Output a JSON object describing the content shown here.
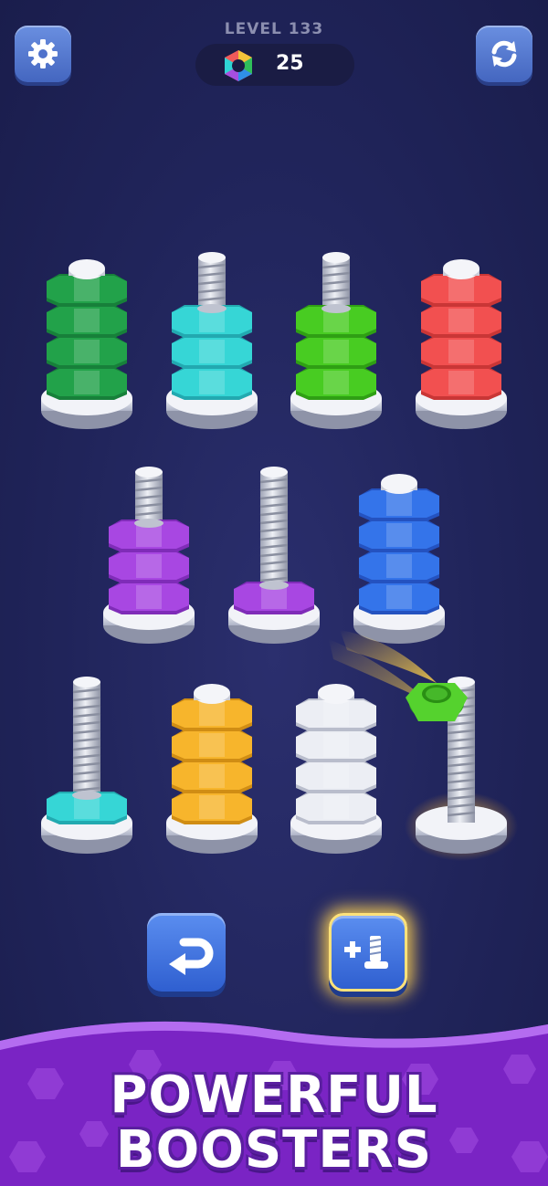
{
  "header": {
    "level_label": "LEVEL 133",
    "coin_count": "25"
  },
  "icons": {
    "settings": "gear-icon",
    "restart": "refresh-icon",
    "coin": "hex-nut-coin-icon",
    "undo": "undo-arrow-icon",
    "add_screw": "plus-screw-icon"
  },
  "colors": {
    "background": "#20245a",
    "nut_green": "#22a24a",
    "nut_cyan": "#2fd4d4",
    "nut_lime": "#44cc22",
    "nut_red": "#f04a4a",
    "nut_purple": "#a23ee0",
    "nut_blue": "#2f6fe8",
    "nut_yellow": "#f5b42a",
    "nut_white": "#e4e6ee",
    "button_blue": "#3f6fd8",
    "banner_purple": "#8a2fd0"
  },
  "board": {
    "screws": [
      {
        "id": "screw-1",
        "nuts": [
          "green",
          "green",
          "green",
          "green"
        ]
      },
      {
        "id": "screw-2",
        "nuts": [
          "cyan",
          "cyan",
          "cyan"
        ]
      },
      {
        "id": "screw-3",
        "nuts": [
          "lime",
          "lime",
          "lime"
        ]
      },
      {
        "id": "screw-4",
        "nuts": [
          "red",
          "red",
          "red",
          "red"
        ]
      },
      {
        "id": "screw-5",
        "nuts": [
          "purple",
          "purple",
          "purple"
        ]
      },
      {
        "id": "screw-6",
        "nuts": [
          "purple"
        ]
      },
      {
        "id": "screw-7",
        "nuts": [
          "blue",
          "blue",
          "blue",
          "blue"
        ]
      },
      {
        "id": "screw-8",
        "nuts": [
          "cyan"
        ]
      },
      {
        "id": "screw-9",
        "nuts": [
          "yellow",
          "yellow",
          "yellow",
          "yellow"
        ]
      },
      {
        "id": "screw-10",
        "nuts": [
          "white",
          "white",
          "white",
          "white"
        ]
      },
      {
        "id": "screw-11",
        "nuts": [],
        "highlighted": true
      }
    ],
    "flying_nut": "lime"
  },
  "banner": {
    "line1": "POWERFUL",
    "line2": "BOOSTERS"
  }
}
